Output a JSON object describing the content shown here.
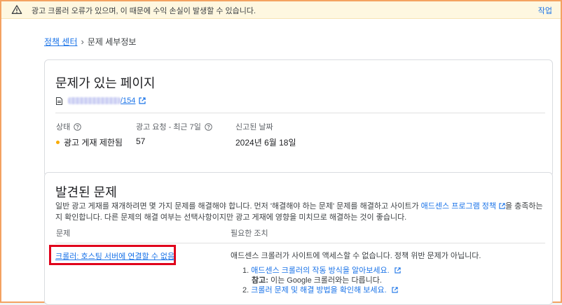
{
  "warning": {
    "text": "광고 크롤러 오류가 있으며, 이 때문에 수익 손실이 발생할 수 있습니다.",
    "action": "작업"
  },
  "breadcrumb": {
    "parent": "정책 센터",
    "separator": "›",
    "current": "문제 세부정보"
  },
  "page_card": {
    "title": "문제가 있는 페이지",
    "url_suffix": "/154",
    "columns": {
      "status_label": "상태",
      "status_value": "광고 게재 제한됨",
      "requests_label": "광고 요청 - 최근 7일",
      "requests_value": "57",
      "reported_label": "신고된 날짜",
      "reported_value": "2024년 6월 18일"
    },
    "status_color": "#f9ab00"
  },
  "issues_card": {
    "title": "발견된 문제",
    "desc_part1": "일반 광고 게재를 재개하려면 몇 가지 문제를 해결해야 합니다. 먼저 '해결해야 하는 문제' 문제를 해결하고 사이트가 ",
    "desc_link": "애드센스 프로그램 정책",
    "desc_part2": "을 충족하는지 확인합니다. 다른 문제의 해결 여부는 선택사항이지만 광고 게재에 영향을 미치므로 해결하는 것이 좋습니다.",
    "col_issue": "문제",
    "col_action": "필요한 조치",
    "issue_label": "크롤러: 호스팅 서버에 연결할 수 없음",
    "action_text": "애드센스 크롤러가 사이트에 액세스할 수 없습니다. 정책 위반 문제가 아닙니다.",
    "step1_num": "1.",
    "step1_link": "애드센스 크롤러의 작동 방식을 알아보세요.",
    "note_label": "참고:",
    "note_text": " 이는 Google 크롤러와는 다릅니다.",
    "step2_num": "2.",
    "step2_link": "크롤러 문제 및 해결 방법을 확인해 보세요."
  },
  "colors": {
    "link": "#1a73e8",
    "highlight_box": "#e0001b",
    "warning_bg": "#fef7e0"
  }
}
